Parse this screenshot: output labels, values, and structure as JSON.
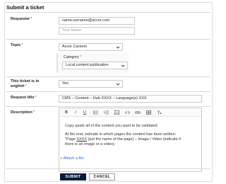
{
  "form": {
    "title": "Submit a ticket",
    "requester": {
      "label": "Requester",
      "required_mark": "*",
      "email_value": "name.surname@accor.com",
      "name_placeholder": "Your Name"
    },
    "topic": {
      "label": "Topic",
      "required_mark": "*",
      "value": "Accor Careers"
    },
    "category": {
      "label": "Category",
      "required_mark": "*",
      "value": "Local content publication"
    },
    "english": {
      "label_line1": "This ticket is in",
      "label_line2": "english",
      "required_mark": "*",
      "value": "Yes"
    },
    "request_title": {
      "label": "Request title",
      "required_mark": "*",
      "value": "CMS – Content – Hub XXXX – Language(s) XXX"
    },
    "description": {
      "label": "Description",
      "required_mark": "*",
      "toolbar": [
        "B",
        "I",
        "U",
        "bulleted-list",
        "numbered-list",
        "image",
        "code",
        "link",
        "table",
        "clear-format"
      ],
      "paragraph1": "Copy paste all of the content you want to be validated.",
      "paragraph2_a": "At the end, indicate in which pages the content has been written:",
      "paragraph2_b_prefix": "\"Page ",
      "paragraph2_b_link": "XXXX",
      "paragraph2_b_suffix": " (put the name of the page) – Image / Video (indicate if",
      "paragraph2_c": "there is an image or a video)."
    },
    "attach_label": "+ Attach a file",
    "submit_label": "SUBMIT",
    "cancel_label": "CANCEL"
  },
  "colors": {
    "primary": "#0b1a3b",
    "required": "#c0392b",
    "link": "#2c6fd1",
    "border": "#c9c9c9"
  }
}
